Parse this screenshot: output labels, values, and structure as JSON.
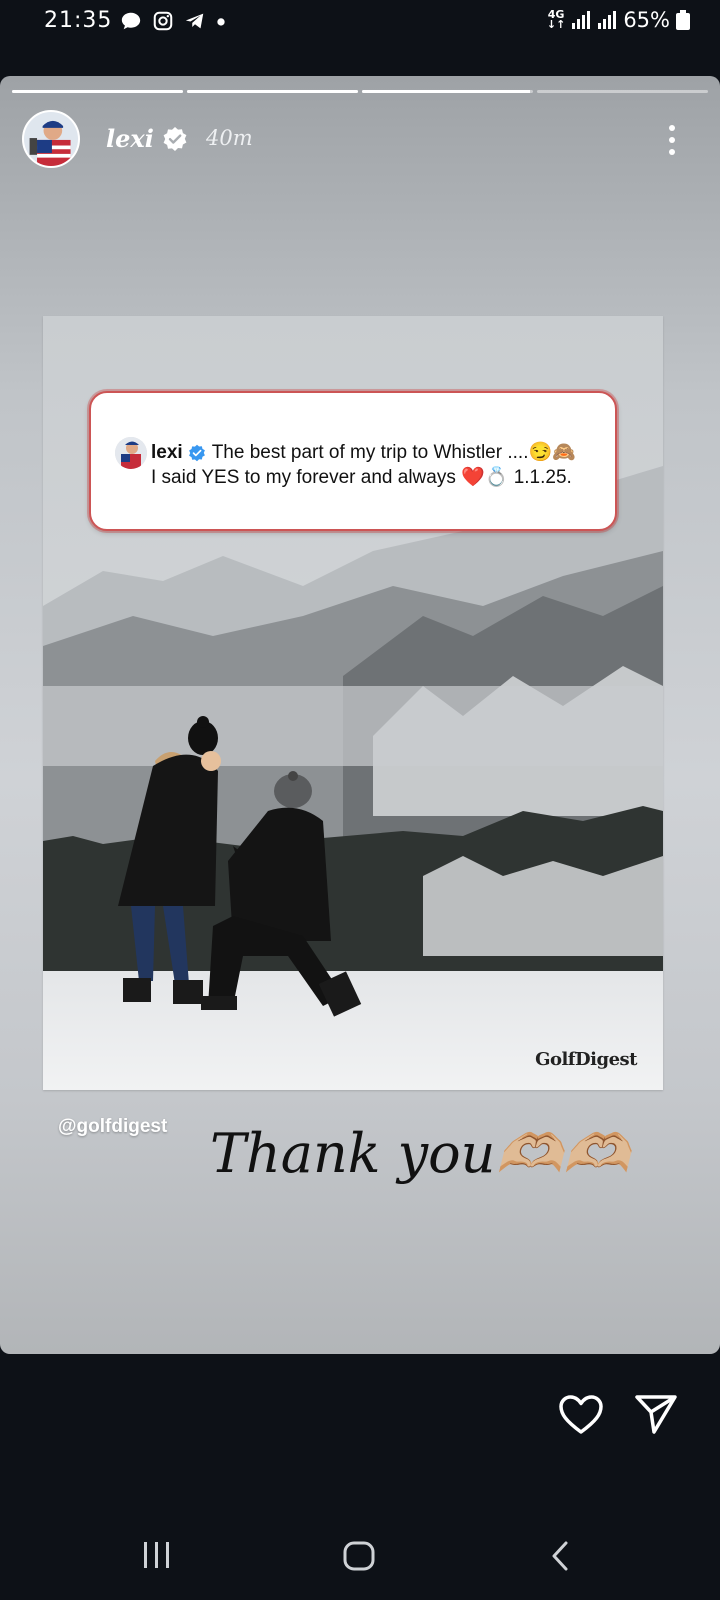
{
  "status_bar": {
    "time": "21:35",
    "network": "4G",
    "battery": "65%",
    "left_icons": [
      "chat-bubble-icon",
      "instagram-icon",
      "telegram-icon",
      "dot-icon"
    ]
  },
  "story": {
    "progress": [
      1.0,
      1.0,
      0.98,
      0.0
    ],
    "username": "lexi",
    "time_ago": "40m",
    "post": {
      "caption_user": "lexi",
      "caption_line1": "The best part of my trip to Whistler ....😏🙈",
      "caption_line2": "I said YES to my forever and always ❤️💍 1.1.25.",
      "watermark": "GolfDigest"
    },
    "mention": "@golfdigest",
    "sticker_text": "Thank you🫶🏼🫶🏼"
  },
  "colors": {
    "verified_blue": "#3897f0",
    "caption_border": "#cc5555",
    "background": "#0d1117"
  }
}
